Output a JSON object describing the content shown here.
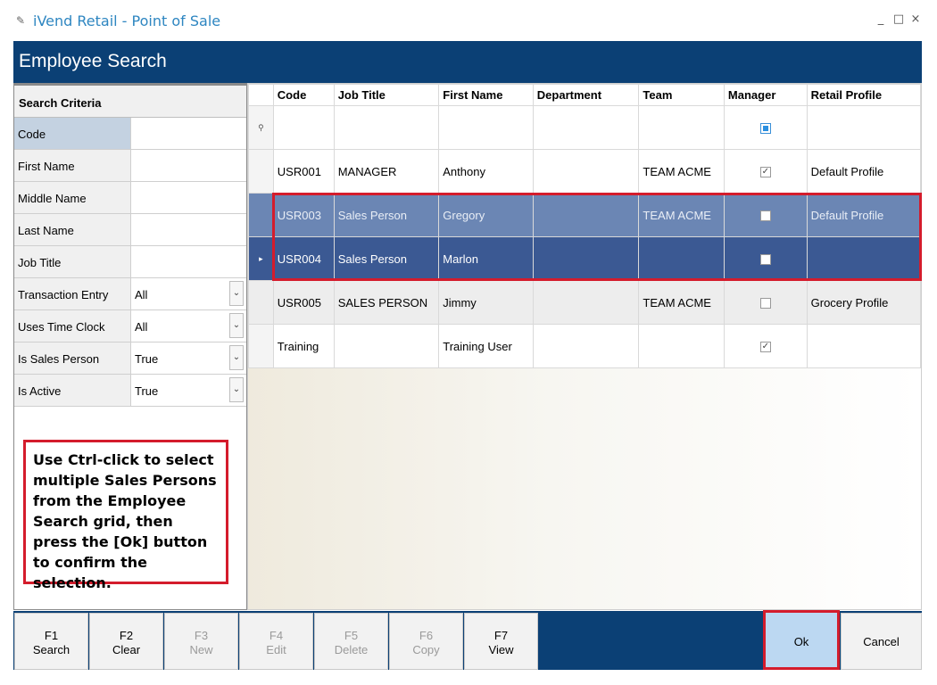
{
  "window": {
    "title": "iVend Retail - Point of Sale",
    "icon": "pos-app-icon",
    "controls": [
      "_",
      "□",
      "×"
    ]
  },
  "header": {
    "title": "Employee Search"
  },
  "criteria": {
    "heading": "Search Criteria",
    "fields": [
      {
        "label": "Code",
        "value": ""
      },
      {
        "label": "First Name",
        "value": ""
      },
      {
        "label": "Middle Name",
        "value": ""
      },
      {
        "label": "Last Name",
        "value": ""
      },
      {
        "label": "Job Title",
        "value": ""
      },
      {
        "label": "Transaction Entry",
        "value": "All",
        "dropdown": true
      },
      {
        "label": "Uses Time Clock",
        "value": "All",
        "dropdown": true
      },
      {
        "label": "Is Sales Person",
        "value": "True",
        "dropdown": true
      },
      {
        "label": "Is Active",
        "value": "True",
        "dropdown": true
      }
    ]
  },
  "note": {
    "text": "Use Ctrl-click to select multiple Sales Persons from the Employee Search grid, then press the [Ok] button to confirm the selection."
  },
  "grid": {
    "columns": [
      "Code",
      "Job Title",
      "First Name",
      "Department",
      "Team",
      "Manager",
      "Retail Profile"
    ],
    "rows": [
      {
        "code": "USR001",
        "job_title": "MANAGER",
        "first_name": "Anthony",
        "department": "",
        "team": "TEAM ACME",
        "manager": true,
        "retail_profile": "Default Profile"
      },
      {
        "code": "USR003",
        "job_title": "Sales Person",
        "first_name": "Gregory",
        "department": "",
        "team": "TEAM ACME",
        "manager": false,
        "retail_profile": "Default Profile"
      },
      {
        "code": "USR004",
        "job_title": "Sales Person",
        "first_name": "Marlon",
        "department": "",
        "team": "",
        "manager": false,
        "retail_profile": ""
      },
      {
        "code": "USR005",
        "job_title": "SALES PERSON",
        "first_name": "Jimmy",
        "department": "",
        "team": "TEAM ACME",
        "manager": false,
        "retail_profile": "Grocery Profile"
      },
      {
        "code": "Training",
        "job_title": "",
        "first_name": "Training User",
        "department": "",
        "team": "",
        "manager": true,
        "retail_profile": ""
      }
    ]
  },
  "footer": {
    "keys": [
      {
        "key": "F1",
        "label": "Search",
        "enabled": true
      },
      {
        "key": "F2",
        "label": "Clear",
        "enabled": true
      },
      {
        "key": "F3",
        "label": "New",
        "enabled": false
      },
      {
        "key": "F4",
        "label": "Edit",
        "enabled": false
      },
      {
        "key": "F5",
        "label": "Delete",
        "enabled": false
      },
      {
        "key": "F6",
        "label": "Copy",
        "enabled": false
      },
      {
        "key": "F7",
        "label": "View",
        "enabled": true
      }
    ],
    "ok_label": "Ok",
    "cancel_label": "Cancel"
  },
  "colors": {
    "header_blue": "#0b4075",
    "selected_row": "#6b86b4",
    "current_row": "#3b5993",
    "highlight_red": "#d41c2c",
    "ok_button": "#bcd8f2"
  }
}
